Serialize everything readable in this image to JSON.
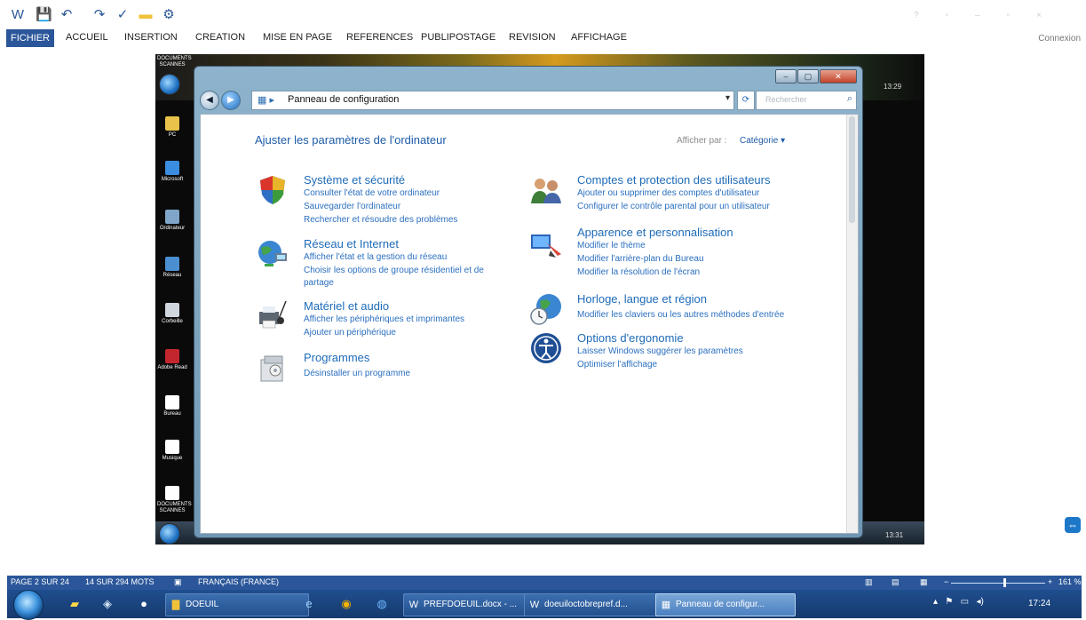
{
  "word": {
    "ribbon_tabs": [
      "FICHIER",
      "ACCUEIL",
      "INSERTION",
      "CREATION",
      "MISE EN PAGE",
      "REFERENCES",
      "PUBLIPOSTAGE",
      "REVISION",
      "AFFICHAGE"
    ],
    "connexion": "Connexion"
  },
  "photo": {
    "desktop_icons": [
      "DOCUMENTS SCANNES",
      "PC",
      "Microsoft",
      "Ordinateur",
      "Réseau",
      "Corbeille",
      "Adobe Read",
      "Bureau",
      "Musique",
      "DOCUMENTS SCANNES"
    ],
    "clock_top": "13:29",
    "clock_bottom": "13:31"
  },
  "control_panel": {
    "address": "Panneau de configuration",
    "search_placeholder": "Rechercher",
    "heading": "Ajuster les paramètres de l'ordinateur",
    "view_by_label": "Afficher par :",
    "view_by_value": "Catégorie ▾",
    "categories": [
      {
        "title": "Système et sécurité",
        "links": [
          "Consulter l'état de votre ordinateur",
          "Sauvegarder l'ordinateur",
          "Rechercher et résoudre des problèmes"
        ]
      },
      {
        "title": "Réseau et Internet",
        "links": [
          "Afficher l'état et la gestion du réseau",
          "Choisir les options de groupe résidentiel et de partage"
        ]
      },
      {
        "title": "Matériel et audio",
        "links": [
          "Afficher les périphériques et imprimantes",
          "Ajouter un périphérique"
        ]
      },
      {
        "title": "Programmes",
        "links": [
          "Désinstaller un programme"
        ]
      },
      {
        "title": "Comptes et protection des utilisateurs",
        "links": [
          "Ajouter ou supprimer des comptes d'utilisateur",
          "Configurer le contrôle parental pour un utilisateur"
        ]
      },
      {
        "title": "Apparence et personnalisation",
        "links": [
          "Modifier le thème",
          "Modifier l'arrière-plan du Bureau",
          "Modifier la résolution de l'écran"
        ]
      },
      {
        "title": "Horloge, langue et région",
        "links": [
          "Modifier les claviers ou les autres méthodes d'entrée"
        ]
      },
      {
        "title": "Options d'ergonomie",
        "links": [
          "Laisser Windows suggérer les paramètres",
          "Optimiser l'affichage"
        ]
      }
    ]
  },
  "statusbar": {
    "page": "PAGE 2 SUR 24",
    "words": "14 SUR 294 MOTS",
    "language": "FRANÇAIS (FRANCE)",
    "zoom": "161 %"
  },
  "taskbar": {
    "buttons": [
      "DOEUIL",
      "PREFDOEUIL.docx - ...",
      "doeuiloctobrepref.d...",
      "Panneau de configur..."
    ],
    "clock": "17:24"
  }
}
